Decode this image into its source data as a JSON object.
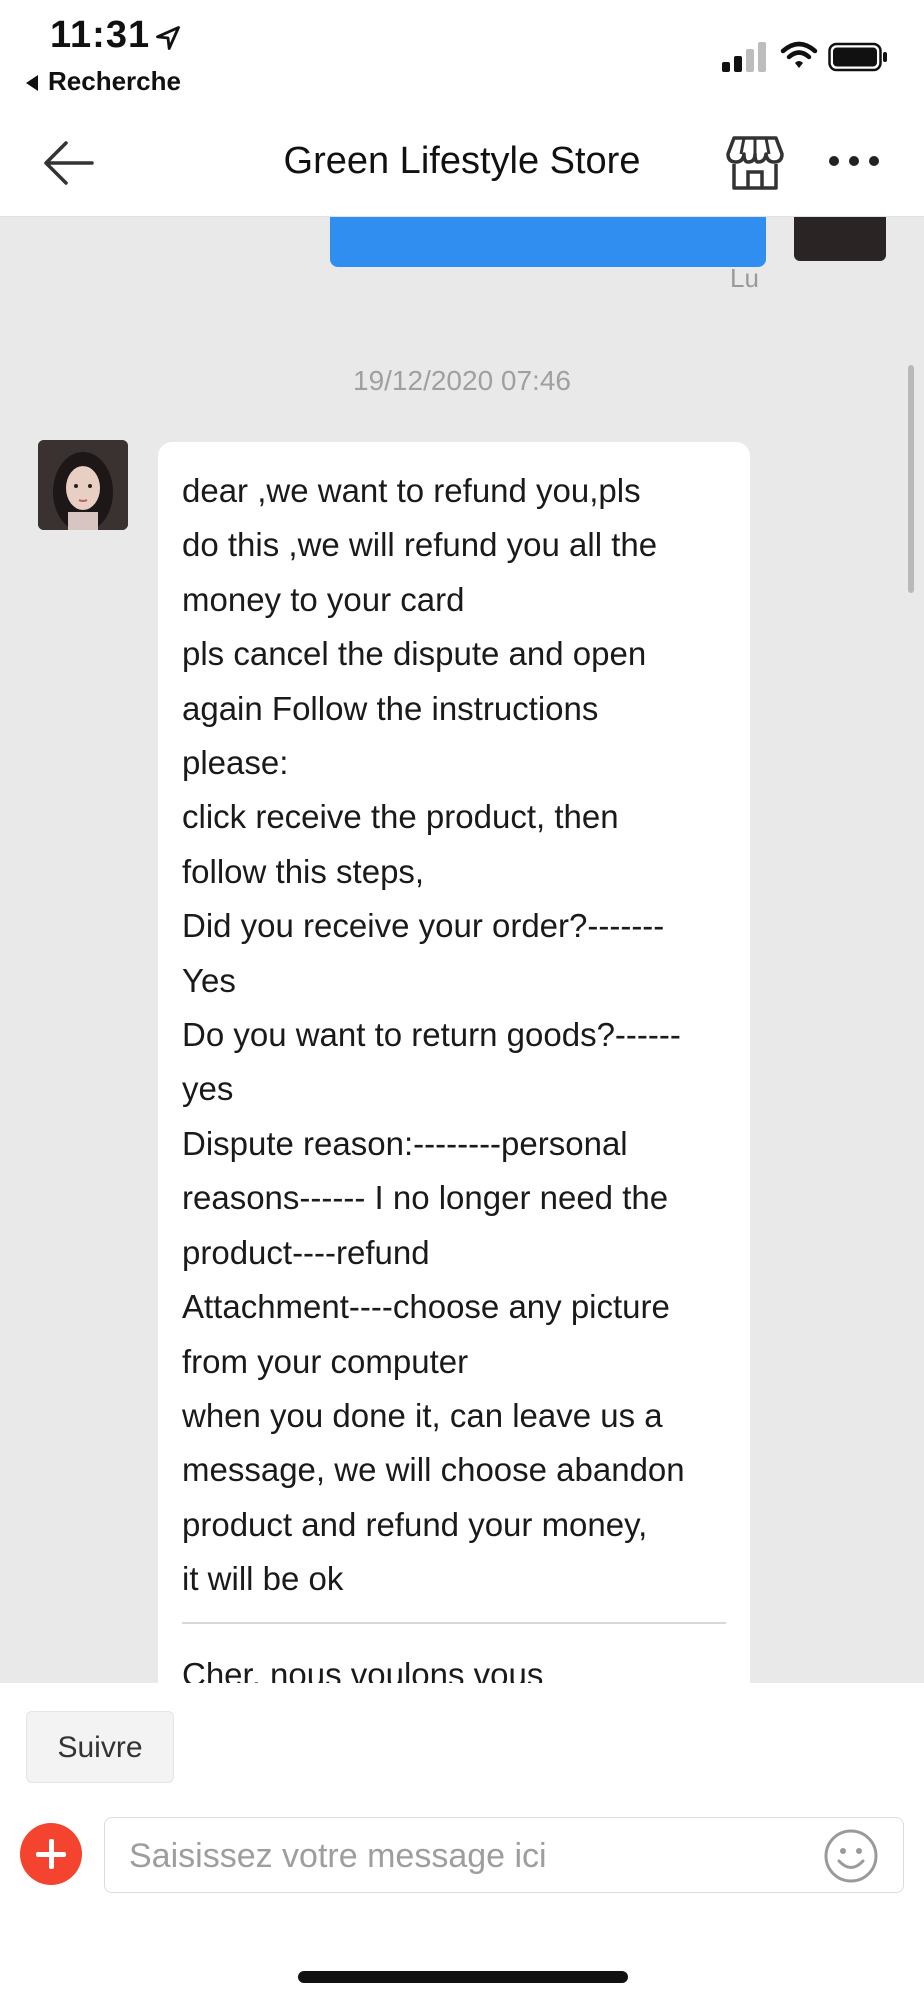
{
  "status_bar": {
    "time": "11:31",
    "back_app": "Recherche"
  },
  "nav": {
    "title": "Green Lifestyle Store"
  },
  "chat": {
    "read_label": "Lu",
    "timestamp": "19/12/2020 07:46",
    "message_lines": [
      "dear ,we want to refund you,pls",
      "do this ,we will refund you all the",
      "money to your card",
      "pls cancel the dispute and open",
      "again Follow the instructions",
      "please:",
      "click receive the product, then",
      "follow this steps,",
      "Did you receive your order?-------",
      "Yes",
      "Do you want to return goods?------",
      "yes",
      "Dispute reason:--------personal",
      "reasons------ I no longer need the",
      "product----refund",
      "Attachment----choose any picture",
      "from your computer",
      "when you done it, can leave us a",
      "message, we will choose abandon",
      "product and refund your money,",
      "it will be ok"
    ],
    "message_french_partial": "Cher, nous voulons vous"
  },
  "bottom": {
    "follow_label": "Suivre",
    "input_placeholder": "Saisissez votre message ici"
  },
  "colors": {
    "accent_blue": "#2f8ef0",
    "plus_red": "#f4432e",
    "chat_bg": "#e9e9e9"
  }
}
